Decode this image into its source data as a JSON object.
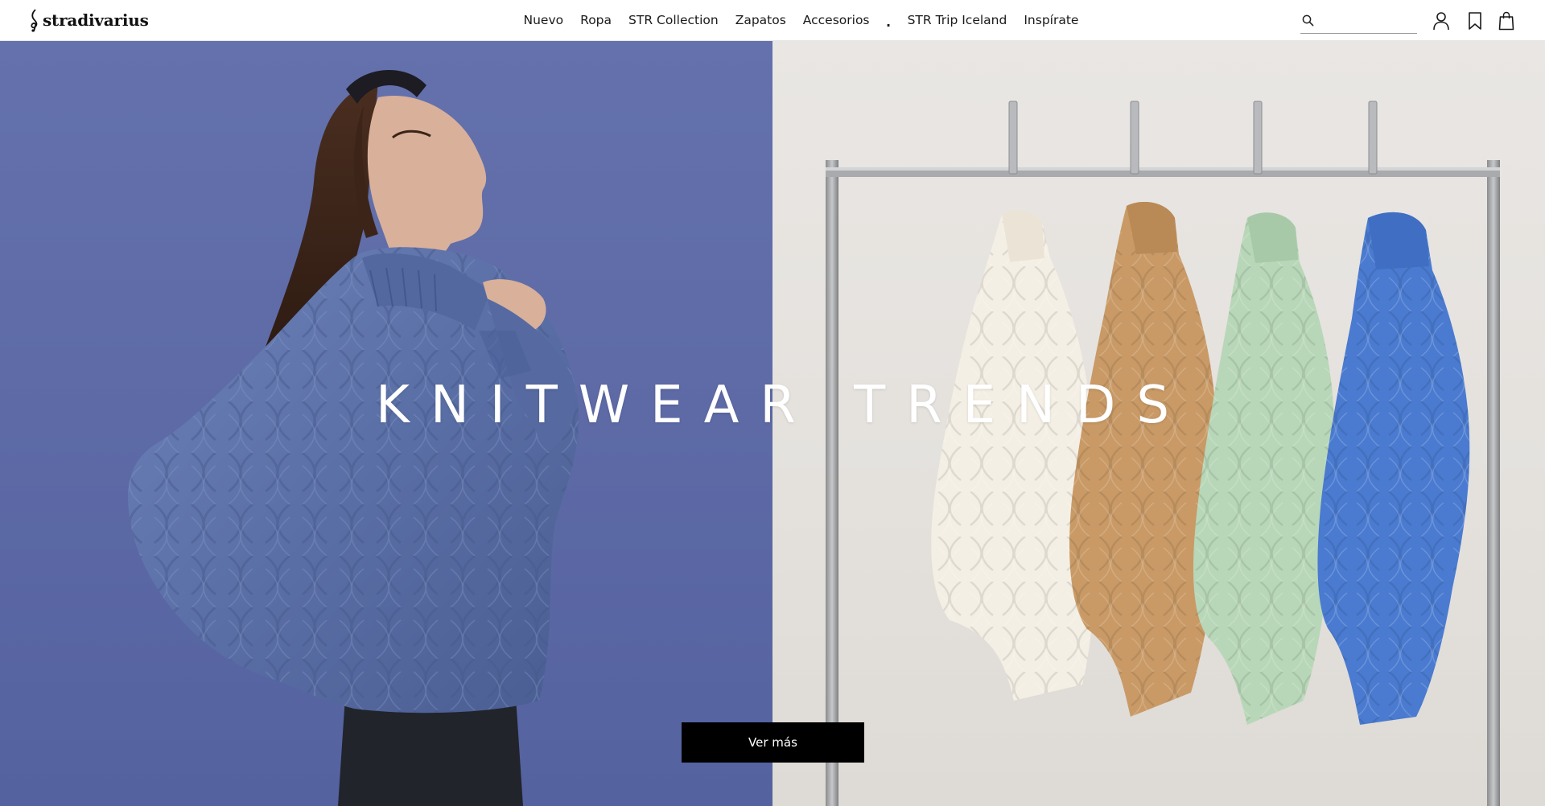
{
  "header": {
    "logo_text": "stradivarius",
    "nav": [
      {
        "label": "Nuevo"
      },
      {
        "label": "Ropa"
      },
      {
        "label": "STR Collection"
      },
      {
        "label": "Zapatos"
      },
      {
        "label": "Accesorios"
      },
      {
        "label": "."
      },
      {
        "label": "STR Trip Iceland"
      },
      {
        "label": "Inspírate"
      }
    ],
    "search": {
      "placeholder": "",
      "value": ""
    },
    "icons": [
      "search-icon",
      "user-icon",
      "bookmark-icon",
      "shopping-bag-icon"
    ]
  },
  "hero": {
    "title": "KNITWEAR TRENDS",
    "cta_label": "Ver más",
    "colors": {
      "left_background": "#5d6aa6",
      "right_background": "#e6e3df",
      "title_color": "#ffffff",
      "cta_background": "#000000"
    },
    "images": {
      "left": "model-in-blue-cable-knit-turtleneck",
      "right": "four-turtleneck-sweaters-on-clothing-rack"
    }
  }
}
